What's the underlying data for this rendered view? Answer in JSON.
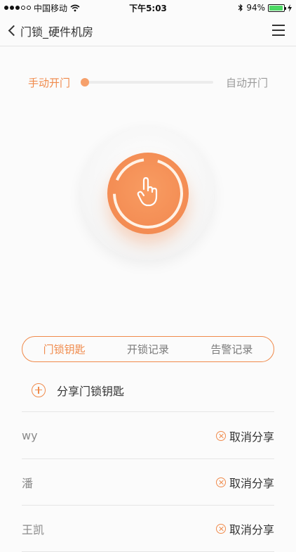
{
  "status_bar": {
    "carrier": "中国移动",
    "time": "下午5:03",
    "battery": "94%",
    "battery_level": 0.94
  },
  "nav": {
    "title": "门锁_硬件机房"
  },
  "mode": {
    "left_label": "手动开门",
    "right_label": "自动开门",
    "selected": "手动开门"
  },
  "tabs": [
    {
      "label": "门锁钥匙",
      "active": true
    },
    {
      "label": "开锁记录",
      "active": false
    },
    {
      "label": "告警记录",
      "active": false
    }
  ],
  "share": {
    "label": "分享门锁钥匙"
  },
  "keys": [
    {
      "name": "wy",
      "action": "取消分享"
    },
    {
      "name": "潘",
      "action": "取消分享"
    },
    {
      "name": "王凯",
      "action": "取消分享"
    }
  ],
  "colors": {
    "accent": "#f08a4b",
    "button": "#f48e55"
  }
}
